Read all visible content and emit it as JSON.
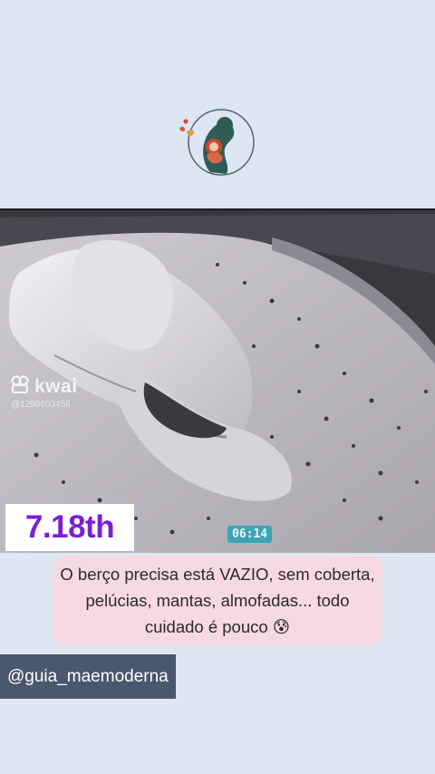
{
  "brand": {
    "logo_icon": "mother-baby-logo-icon"
  },
  "video": {
    "watermark": {
      "app_name": "kwai",
      "user_id": "@1298603456",
      "icon": "kwai-camera-icon"
    },
    "timestamp": "06:14"
  },
  "rank_badge": "7.18th",
  "caption": {
    "text": "O berço precisa está VAZIO, sem coberta, pelúcias, mantas, almofadas... todo cuidado é pouco 😰"
  },
  "handle": "@guia_maemoderna",
  "colors": {
    "background": "#dde6f2",
    "rank_text": "#7b1fd6",
    "caption_bg": "#f6d9e2",
    "handle_bg": "#4a576d",
    "timestamp_bg": "#3ba5b5"
  }
}
